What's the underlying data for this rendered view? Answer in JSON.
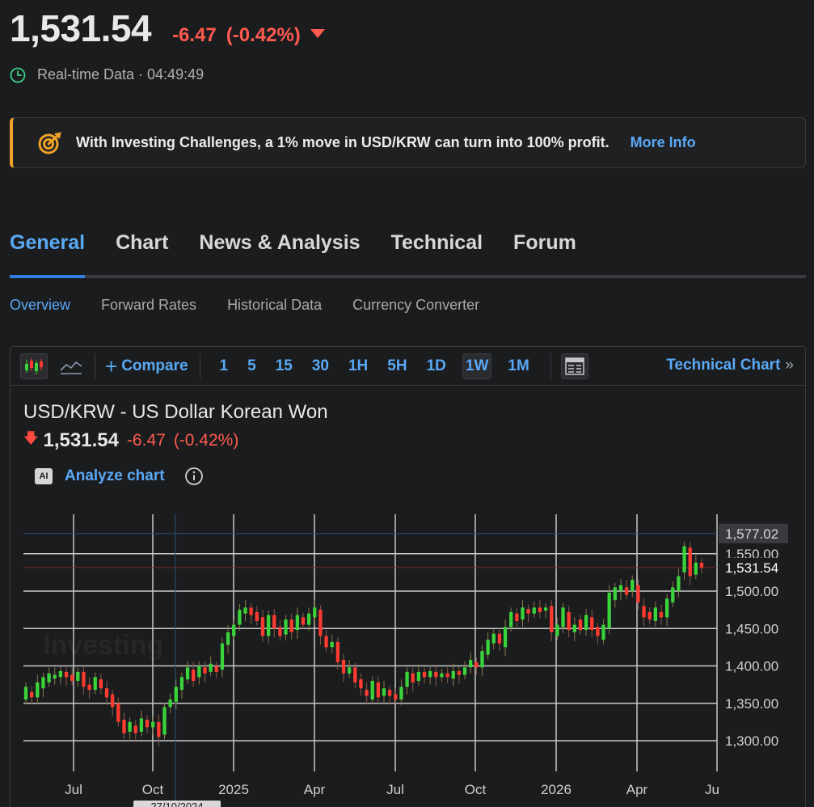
{
  "quote": {
    "price": "1,531.54",
    "change": "-6.47",
    "change_pct": "(-0.42%)",
    "direction_icon": "triangle-down-icon",
    "status": "Real-time Data · 04:49:49"
  },
  "banner": {
    "text": "With Investing Challenges, a 1% move in USD/KRW can turn into 100% profit.",
    "link": "More Info",
    "accent": "#f0a128"
  },
  "main_tabs": [
    {
      "label": "General",
      "active": true
    },
    {
      "label": "Chart",
      "active": false
    },
    {
      "label": "News & Analysis",
      "active": false
    },
    {
      "label": "Technical",
      "active": false
    },
    {
      "label": "Forum",
      "active": false
    }
  ],
  "sub_tabs": [
    {
      "label": "Overview",
      "active": true
    },
    {
      "label": "Forward Rates",
      "active": false
    },
    {
      "label": "Historical Data",
      "active": false
    },
    {
      "label": "Currency Converter",
      "active": false
    }
  ],
  "toolbar": {
    "compare": "Compare",
    "timeframes": [
      "1",
      "5",
      "15",
      "30",
      "1H",
      "5H",
      "1D",
      "1W",
      "1M"
    ],
    "selected_timeframe": "1W",
    "technical_chart": "Technical Chart",
    "technical_chevron": "»"
  },
  "chart_header": {
    "title": "USD/KRW - US Dollar Korean Won",
    "price": "1,531.54",
    "change": "-6.47",
    "change_pct": "(-0.42%)",
    "analyze": "Analyze chart",
    "ai_badge": "AI"
  },
  "colors": {
    "up": "#3ad43a",
    "down": "#ff3b30",
    "accent": "#5aa9f5",
    "negative_text": "#ff5a4f"
  },
  "chart_data": {
    "type": "candlestick",
    "x_tick_labels": [
      "Jul",
      "Oct",
      "2025",
      "Apr",
      "Jul",
      "Oct",
      "2026",
      "Apr",
      "Ju"
    ],
    "y_tick_labels": [
      "1,577.02",
      "1,550.00",
      "1,531.54",
      "1,500.00",
      "1,450.00",
      "1,400.00",
      "1,350.00",
      "1,300.00"
    ],
    "ylim": [
      1260,
      1595
    ],
    "last_price": 1531.54,
    "high_marker": 1577.02,
    "crosshair_date": "27/10/2024",
    "grid": true,
    "weeks_per_month_step": 13,
    "series": [
      {
        "o": 1355,
        "c": 1372
      },
      {
        "o": 1365,
        "c": 1358
      },
      {
        "o": 1358,
        "c": 1378
      },
      {
        "o": 1370,
        "c": 1385
      },
      {
        "o": 1378,
        "c": 1390
      },
      {
        "o": 1383,
        "c": 1388
      },
      {
        "o": 1385,
        "c": 1393
      },
      {
        "o": 1392,
        "c": 1385
      },
      {
        "o": 1388,
        "c": 1380
      },
      {
        "o": 1380,
        "c": 1392
      },
      {
        "o": 1392,
        "c": 1372
      },
      {
        "o": 1375,
        "c": 1368
      },
      {
        "o": 1368,
        "c": 1385
      },
      {
        "o": 1382,
        "c": 1370
      },
      {
        "o": 1370,
        "c": 1358
      },
      {
        "o": 1362,
        "c": 1345
      },
      {
        "o": 1350,
        "c": 1325
      },
      {
        "o": 1328,
        "c": 1310
      },
      {
        "o": 1312,
        "c": 1325
      },
      {
        "o": 1320,
        "c": 1310
      },
      {
        "o": 1312,
        "c": 1330
      },
      {
        "o": 1328,
        "c": 1318
      },
      {
        "o": 1318,
        "c": 1325
      },
      {
        "o": 1325,
        "c": 1305
      },
      {
        "o": 1308,
        "c": 1345
      },
      {
        "o": 1345,
        "c": 1355
      },
      {
        "o": 1352,
        "c": 1372
      },
      {
        "o": 1368,
        "c": 1385
      },
      {
        "o": 1382,
        "c": 1398
      },
      {
        "o": 1395,
        "c": 1380
      },
      {
        "o": 1385,
        "c": 1400
      },
      {
        "o": 1398,
        "c": 1390
      },
      {
        "o": 1392,
        "c": 1403
      },
      {
        "o": 1400,
        "c": 1392
      },
      {
        "o": 1395,
        "c": 1430
      },
      {
        "o": 1428,
        "c": 1445
      },
      {
        "o": 1440,
        "c": 1455
      },
      {
        "o": 1455,
        "c": 1475
      },
      {
        "o": 1470,
        "c": 1478
      },
      {
        "o": 1478,
        "c": 1468
      },
      {
        "o": 1472,
        "c": 1460
      },
      {
        "o": 1465,
        "c": 1440
      },
      {
        "o": 1440,
        "c": 1468
      },
      {
        "o": 1468,
        "c": 1450
      },
      {
        "o": 1452,
        "c": 1440
      },
      {
        "o": 1442,
        "c": 1462
      },
      {
        "o": 1462,
        "c": 1445
      },
      {
        "o": 1448,
        "c": 1468
      },
      {
        "o": 1465,
        "c": 1455
      },
      {
        "o": 1455,
        "c": 1470
      },
      {
        "o": 1465,
        "c": 1478
      },
      {
        "o": 1475,
        "c": 1440
      },
      {
        "o": 1440,
        "c": 1425
      },
      {
        "o": 1425,
        "c": 1432
      },
      {
        "o": 1432,
        "c": 1405
      },
      {
        "o": 1408,
        "c": 1390
      },
      {
        "o": 1390,
        "c": 1398
      },
      {
        "o": 1398,
        "c": 1378
      },
      {
        "o": 1382,
        "c": 1370
      },
      {
        "o": 1368,
        "c": 1360
      },
      {
        "o": 1355,
        "c": 1380
      },
      {
        "o": 1378,
        "c": 1358
      },
      {
        "o": 1360,
        "c": 1370
      },
      {
        "o": 1368,
        "c": 1360
      },
      {
        "o": 1362,
        "c": 1355
      },
      {
        "o": 1355,
        "c": 1372
      },
      {
        "o": 1372,
        "c": 1392
      },
      {
        "o": 1390,
        "c": 1378
      },
      {
        "o": 1380,
        "c": 1392
      },
      {
        "o": 1392,
        "c": 1385
      },
      {
        "o": 1385,
        "c": 1393
      },
      {
        "o": 1392,
        "c": 1385
      },
      {
        "o": 1385,
        "c": 1390
      },
      {
        "o": 1390,
        "c": 1385
      },
      {
        "o": 1383,
        "c": 1393
      },
      {
        "o": 1393,
        "c": 1388
      },
      {
        "o": 1388,
        "c": 1398
      },
      {
        "o": 1398,
        "c": 1408
      },
      {
        "o": 1405,
        "c": 1398
      },
      {
        "o": 1398,
        "c": 1420
      },
      {
        "o": 1415,
        "c": 1435
      },
      {
        "o": 1430,
        "c": 1443
      },
      {
        "o": 1443,
        "c": 1430
      },
      {
        "o": 1425,
        "c": 1452
      },
      {
        "o": 1452,
        "c": 1472
      },
      {
        "o": 1470,
        "c": 1460
      },
      {
        "o": 1462,
        "c": 1478
      },
      {
        "o": 1476,
        "c": 1470
      },
      {
        "o": 1470,
        "c": 1478
      },
      {
        "o": 1478,
        "c": 1472
      },
      {
        "o": 1474,
        "c": 1478
      },
      {
        "o": 1480,
        "c": 1445
      },
      {
        "o": 1440,
        "c": 1455
      },
      {
        "o": 1452,
        "c": 1478
      },
      {
        "o": 1472,
        "c": 1448
      },
      {
        "o": 1445,
        "c": 1455
      },
      {
        "o": 1462,
        "c": 1448
      },
      {
        "o": 1448,
        "c": 1468
      },
      {
        "o": 1465,
        "c": 1448
      },
      {
        "o": 1452,
        "c": 1440
      },
      {
        "o": 1435,
        "c": 1455
      },
      {
        "o": 1450,
        "c": 1498
      },
      {
        "o": 1488,
        "c": 1505
      },
      {
        "o": 1500,
        "c": 1508
      },
      {
        "o": 1505,
        "c": 1495
      },
      {
        "o": 1500,
        "c": 1515
      },
      {
        "o": 1508,
        "c": 1485
      },
      {
        "o": 1480,
        "c": 1465
      },
      {
        "o": 1472,
        "c": 1462
      },
      {
        "o": 1460,
        "c": 1478
      },
      {
        "o": 1472,
        "c": 1465
      },
      {
        "o": 1465,
        "c": 1490
      },
      {
        "o": 1485,
        "c": 1505
      },
      {
        "o": 1500,
        "c": 1520
      },
      {
        "o": 1525,
        "c": 1560
      },
      {
        "o": 1558,
        "c": 1520
      },
      {
        "o": 1522,
        "c": 1538
      },
      {
        "o": 1538,
        "c": 1531.54
      }
    ]
  }
}
